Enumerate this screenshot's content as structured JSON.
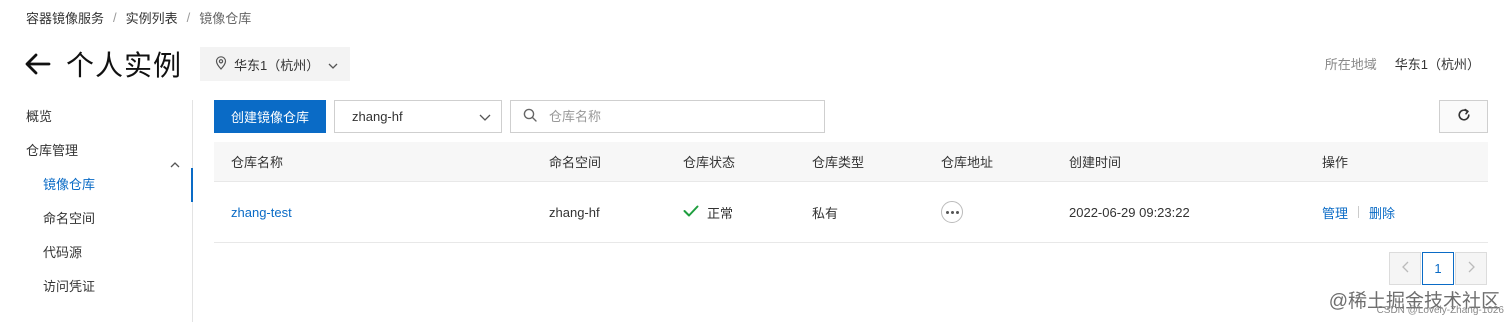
{
  "breadcrumb": {
    "items": [
      "容器镜像服务",
      "实例列表",
      "镜像仓库"
    ],
    "separator": "/"
  },
  "header": {
    "title": "个人实例",
    "region_select": "华东1（杭州）",
    "region_label": "所在地域",
    "region_value": "华东1（杭州）"
  },
  "sidebar": {
    "items": [
      {
        "label": "概览"
      },
      {
        "label": "仓库管理"
      },
      {
        "label": "镜像仓库"
      },
      {
        "label": "命名空间"
      },
      {
        "label": "代码源"
      },
      {
        "label": "访问凭证"
      }
    ]
  },
  "toolbar": {
    "create_label": "创建镜像仓库",
    "namespace_value": "zhang-hf",
    "search_placeholder": "仓库名称"
  },
  "table": {
    "columns": [
      "仓库名称",
      "命名空间",
      "仓库状态",
      "仓库类型",
      "仓库地址",
      "创建时间",
      "操作"
    ],
    "rows": [
      {
        "name": "zhang-test",
        "namespace": "zhang-hf",
        "status": "正常",
        "type": "私有",
        "created": "2022-06-29 09:23:22",
        "action_manage": "管理",
        "action_delete": "删除"
      }
    ]
  },
  "pagination": {
    "current_page": "1"
  },
  "watermark": {
    "main": "@稀土掘金技术社区",
    "sub": "CSDN @Lovely-Zhang-1026"
  },
  "colors": {
    "accent": "#0a6bc6",
    "status_ok": "#1e9e3e"
  }
}
